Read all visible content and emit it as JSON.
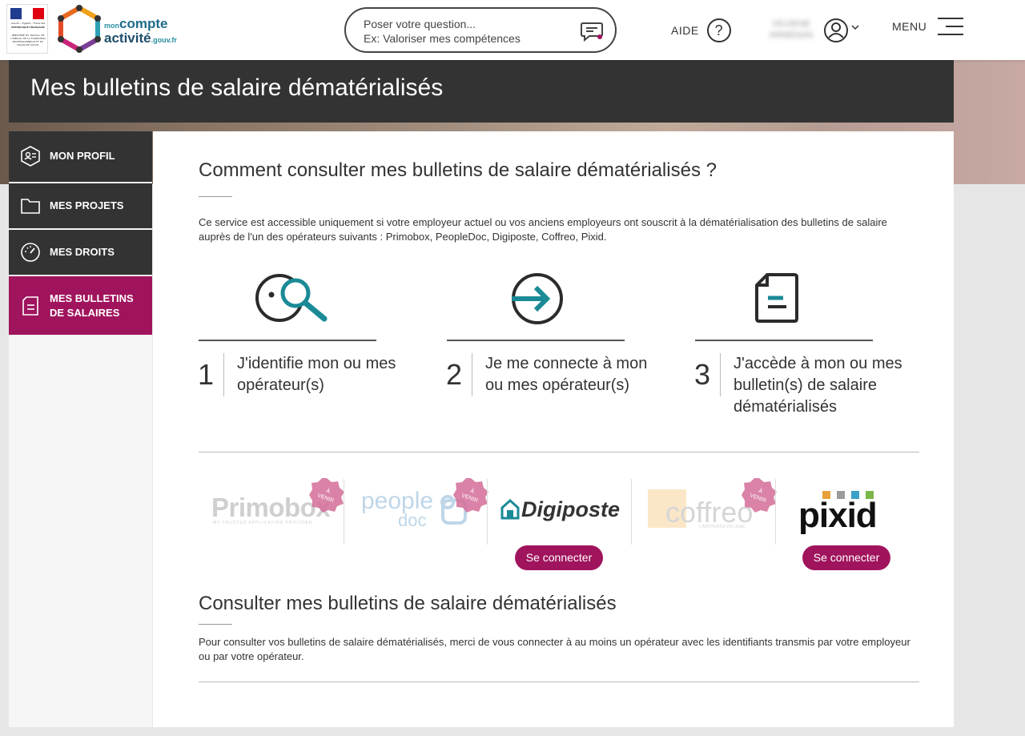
{
  "header": {
    "logo_marianne": {
      "motto": "Liberté • Égalité • Fraternité",
      "republic": "RÉPUBLIQUE FRANÇAISE",
      "ministry": "MINISTÈRE DU TRAVAIL, DE L'EMPLOI, DE LA FORMATION PROFESSIONNELLE ET DU DIALOGUE SOCIAL"
    },
    "brand": {
      "mon": "mon",
      "compte": "compte",
      "activite": "activité",
      "gouv": ".gouv.fr"
    },
    "search": {
      "placeholder_line1": "Poser votre question...",
      "placeholder_line2": "Ex: Valoriser mes compétences",
      "icon": "chat-bubble-icon"
    },
    "aide_label": "AIDE",
    "aide_icon_glyph": "?",
    "user": {
      "name_blurred_line1": "VEUIENE",
      "name_blurred_line2": "ARMENAN",
      "icon": "user-avatar-icon"
    },
    "menu_label": "MENU"
  },
  "page_title": "Mes bulletins de salaire dématérialisés",
  "sidebar": {
    "items": [
      {
        "label": "MON PROFIL",
        "icon": "profile-card-icon",
        "active": false
      },
      {
        "label": "MES PROJETS",
        "icon": "folder-icon",
        "active": false
      },
      {
        "label": "MES DROITS",
        "icon": "gauge-icon",
        "active": false
      },
      {
        "label": "MES BULLETINS DE SALAIRES",
        "icon": "document-icon",
        "active": true
      }
    ]
  },
  "main": {
    "section1_title": "Comment consulter mes bulletins de salaire dématérialisés ?",
    "intro": "Ce service est accessible uniquement si votre employeur actuel ou vos anciens employeurs ont souscrit à la dématérialisation des bulletins de salaire auprès de l'un des opérateurs suivants : Primobox, PeopleDoc, Digiposte, Coffreo, Pixid.",
    "steps": [
      {
        "num": "1",
        "text": "J'identifie mon ou mes opérateur(s)",
        "icon": "face-magnifier-icon"
      },
      {
        "num": "2",
        "text": "Je me connecte à mon ou mes opérateur(s)",
        "icon": "arrow-circle-icon"
      },
      {
        "num": "3",
        "text": "J'accède à mon ou mes bulletin(s) de salaire dématérialisés",
        "icon": "document-icon"
      }
    ],
    "operators": [
      {
        "name": "Primobox",
        "tagline": "MY TRUSTED APPLICATION PROVIDER",
        "coming_soon": true
      },
      {
        "name_top": "people",
        "name_bottom": "doc",
        "coming_soon": true
      },
      {
        "name": "Digiposte",
        "coming_soon": false,
        "button": "Se connecter"
      },
      {
        "name": "coffreo",
        "tagline": "L'ARCHIVAGE EN LIGNE",
        "coming_soon": true
      },
      {
        "name": "pixid",
        "coming_soon": false,
        "button": "Se connecter"
      }
    ],
    "badge_text_line1": "À",
    "badge_text_line2": "VENIR",
    "section2_title": "Consulter mes bulletins de salaire dématérialisés",
    "outro": "Pour consulter vos bulletins de salaire dématérialisés, merci de vous connecter à au moins un opérateur avec les identifiants transmis par votre employeur ou par votre opérateur."
  },
  "colors": {
    "accent": "#a0145d",
    "dark": "#333333",
    "teal": "#1a8a96",
    "badge": "#d46c98"
  }
}
